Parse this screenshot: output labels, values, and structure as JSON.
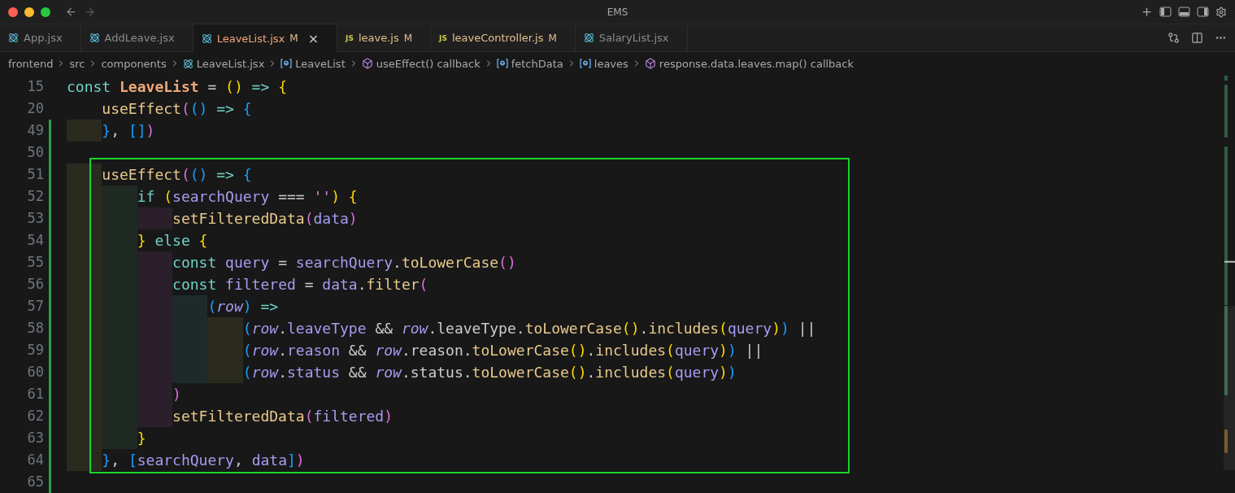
{
  "window": {
    "title": "EMS"
  },
  "tabs": [
    {
      "label": "App.jsx",
      "kind": "react",
      "selected": false
    },
    {
      "label": "AddLeave.jsx",
      "kind": "react",
      "selected": false
    },
    {
      "label": "LeaveList.jsx",
      "kind": "react",
      "selected": true,
      "status": "M",
      "close": "×"
    },
    {
      "label": "leave.js",
      "kind": "js",
      "badge": "JS",
      "selected": false,
      "status": "M"
    },
    {
      "label": "leaveController.js",
      "kind": "js",
      "badge": "JS",
      "selected": false,
      "status": "M"
    },
    {
      "label": "SalaryList.jsx",
      "kind": "react",
      "selected": false
    }
  ],
  "breadcrumbs": [
    {
      "label": "frontend",
      "kind": "folder"
    },
    {
      "label": "src",
      "kind": "folder"
    },
    {
      "label": "components",
      "kind": "folder"
    },
    {
      "label": "LeaveList.jsx",
      "kind": "react"
    },
    {
      "label": "LeaveList",
      "kind": "variable"
    },
    {
      "label": "useEffect() callback",
      "kind": "method"
    },
    {
      "label": "fetchData",
      "kind": "variable"
    },
    {
      "label": "leaves",
      "kind": "variable"
    },
    {
      "label": "response.data.leaves.map() callback",
      "kind": "method"
    }
  ],
  "editor": {
    "blocks": [
      {
        "kind": "plain",
        "lines": [
          {
            "number": "15",
            "modified": false,
            "tokens": [
              {
                "text": "const ",
                "kind": "kw"
              },
              {
                "text": "LeaveList",
                "kind": "cls"
              },
              {
                "text": " = ",
                "kind": "op"
              },
              {
                "text": "()",
                "kind": "b1"
              },
              {
                "text": " => ",
                "kind": "kw"
              },
              {
                "text": "{",
                "kind": "b1"
              }
            ]
          },
          {
            "number": "20",
            "modified": false,
            "guides": [
              {
                "kind": "blank"
              }
            ],
            "tokens": [
              {
                "text": "useEffect",
                "kind": "fn"
              },
              {
                "text": "(",
                "kind": "b2"
              },
              {
                "text": "()",
                "kind": "b3"
              },
              {
                "text": " => ",
                "kind": "kw"
              },
              {
                "text": "{",
                "kind": "b3"
              }
            ]
          },
          {
            "number": "49",
            "modified": true,
            "guides": [
              {
                "kind": "guide",
                "color": "#2a2a1f"
              }
            ],
            "tokens": [
              {
                "text": "}",
                "kind": "b3"
              },
              {
                "text": ", ",
                "kind": "op"
              },
              {
                "text": "[]",
                "kind": "b3"
              },
              {
                "text": ")",
                "kind": "b2"
              }
            ]
          },
          {
            "number": "50",
            "modified": true
          }
        ]
      },
      {
        "kind": "boxed",
        "lines": [
          {
            "number": "51",
            "modified": true,
            "guides": [
              {
                "kind": "guide",
                "color": "#2a2a1f"
              }
            ],
            "tokens": [
              {
                "text": "useEffect",
                "kind": "fn"
              },
              {
                "text": "(",
                "kind": "b2"
              },
              {
                "text": "()",
                "kind": "b3"
              },
              {
                "text": " => ",
                "kind": "kw"
              },
              {
                "text": "{",
                "kind": "b3"
              }
            ]
          },
          {
            "number": "52",
            "modified": true,
            "guides": [
              {
                "kind": "guide",
                "color": "#2a2a1f"
              },
              {
                "kind": "guide",
                "color": "#1f2a22"
              }
            ],
            "tokens": [
              {
                "text": "if ",
                "kind": "kw"
              },
              {
                "text": "(",
                "kind": "b1"
              },
              {
                "text": "searchQuery",
                "kind": "var"
              },
              {
                "text": " === ",
                "kind": "op"
              },
              {
                "text": "''",
                "kind": "str"
              },
              {
                "text": ")",
                "kind": "b1"
              },
              {
                "text": " {",
                "kind": "b1"
              }
            ]
          },
          {
            "number": "53",
            "modified": true,
            "guides": [
              {
                "kind": "guide",
                "color": "#2a2a1f"
              },
              {
                "kind": "guide",
                "color": "#1f2a22"
              },
              {
                "kind": "guide",
                "color": "#2a1f2a"
              }
            ],
            "tokens": [
              {
                "text": "setFilteredData",
                "kind": "fn"
              },
              {
                "text": "(",
                "kind": "b2"
              },
              {
                "text": "data",
                "kind": "var"
              },
              {
                "text": ")",
                "kind": "b2"
              }
            ]
          },
          {
            "number": "54",
            "modified": true,
            "guides": [
              {
                "kind": "guide",
                "color": "#2a2a1f"
              },
              {
                "kind": "guide",
                "color": "#1f2a22"
              }
            ],
            "tokens": [
              {
                "text": "}",
                "kind": "b1"
              },
              {
                "text": " else ",
                "kind": "kw"
              },
              {
                "text": "{",
                "kind": "b1"
              }
            ]
          },
          {
            "number": "55",
            "modified": true,
            "guides": [
              {
                "kind": "guide",
                "color": "#2a2a1f"
              },
              {
                "kind": "guide",
                "color": "#1f2a22"
              },
              {
                "kind": "guide",
                "color": "#2a1f2a"
              }
            ],
            "tokens": [
              {
                "text": "const ",
                "kind": "kw"
              },
              {
                "text": "query",
                "kind": "var"
              },
              {
                "text": " = ",
                "kind": "op"
              },
              {
                "text": "searchQuery",
                "kind": "var"
              },
              {
                "text": ".",
                "kind": "op"
              },
              {
                "text": "toLowerCase",
                "kind": "fn"
              },
              {
                "text": "()",
                "kind": "b2"
              }
            ]
          },
          {
            "number": "56",
            "modified": true,
            "guides": [
              {
                "kind": "guide",
                "color": "#2a2a1f"
              },
              {
                "kind": "guide",
                "color": "#1f2a22"
              },
              {
                "kind": "guide",
                "color": "#2a1f2a"
              }
            ],
            "tokens": [
              {
                "text": "const ",
                "kind": "kw"
              },
              {
                "text": "filtered",
                "kind": "var"
              },
              {
                "text": " = ",
                "kind": "op"
              },
              {
                "text": "data",
                "kind": "var"
              },
              {
                "text": ".",
                "kind": "op"
              },
              {
                "text": "filter",
                "kind": "fn"
              },
              {
                "text": "(",
                "kind": "b2"
              }
            ]
          },
          {
            "number": "57",
            "modified": true,
            "guides": [
              {
                "kind": "guide",
                "color": "#2a2a1f"
              },
              {
                "kind": "guide",
                "color": "#1f2a22"
              },
              {
                "kind": "guide",
                "color": "#2a1f2a"
              },
              {
                "kind": "guide",
                "color": "#1e2a2a"
              }
            ],
            "tokens": [
              {
                "text": "(",
                "kind": "b3"
              },
              {
                "text": "row",
                "kind": "param"
              },
              {
                "text": ")",
                "kind": "b3"
              },
              {
                "text": " =>",
                "kind": "kw"
              }
            ]
          },
          {
            "number": "58",
            "modified": true,
            "guides": [
              {
                "kind": "guide",
                "color": "#2a2a1f"
              },
              {
                "kind": "guide",
                "color": "#1f2a22"
              },
              {
                "kind": "guide",
                "color": "#2a1f2a"
              },
              {
                "kind": "guide",
                "color": "#1e2a2a"
              },
              {
                "kind": "guide",
                "color": "#2a2a1f"
              }
            ],
            "tokens": [
              {
                "text": "(",
                "kind": "b3"
              },
              {
                "text": "row",
                "kind": "param"
              },
              {
                "text": ".",
                "kind": "op"
              },
              {
                "text": "leaveType",
                "kind": "var"
              },
              {
                "text": " && ",
                "kind": "op"
              },
              {
                "text": "row",
                "kind": "param"
              },
              {
                "text": ".leaveType.",
                "kind": "op"
              },
              {
                "text": "toLowerCase",
                "kind": "fn"
              },
              {
                "text": "()",
                "kind": "b1"
              },
              {
                "text": ".",
                "kind": "op"
              },
              {
                "text": "includes",
                "kind": "fn"
              },
              {
                "text": "(",
                "kind": "b1"
              },
              {
                "text": "query",
                "kind": "var"
              },
              {
                "text": ")",
                "kind": "b1"
              },
              {
                "text": ")",
                "kind": "b3"
              },
              {
                "text": " ||",
                "kind": "op"
              }
            ]
          },
          {
            "number": "59",
            "modified": true,
            "guides": [
              {
                "kind": "guide",
                "color": "#2a2a1f"
              },
              {
                "kind": "guide",
                "color": "#1f2a22"
              },
              {
                "kind": "guide",
                "color": "#2a1f2a"
              },
              {
                "kind": "guide",
                "color": "#1e2a2a"
              },
              {
                "kind": "guide",
                "color": "#2a2a1f"
              }
            ],
            "tokens": [
              {
                "text": "(",
                "kind": "b3"
              },
              {
                "text": "row",
                "kind": "param"
              },
              {
                "text": ".",
                "kind": "op"
              },
              {
                "text": "reason",
                "kind": "var"
              },
              {
                "text": " && ",
                "kind": "op"
              },
              {
                "text": "row",
                "kind": "param"
              },
              {
                "text": ".reason.",
                "kind": "op"
              },
              {
                "text": "toLowerCase",
                "kind": "fn"
              },
              {
                "text": "()",
                "kind": "b1"
              },
              {
                "text": ".",
                "kind": "op"
              },
              {
                "text": "includes",
                "kind": "fn"
              },
              {
                "text": "(",
                "kind": "b1"
              },
              {
                "text": "query",
                "kind": "var"
              },
              {
                "text": ")",
                "kind": "b1"
              },
              {
                "text": ")",
                "kind": "b3"
              },
              {
                "text": " ||",
                "kind": "op"
              }
            ]
          },
          {
            "number": "60",
            "modified": true,
            "guides": [
              {
                "kind": "guide",
                "color": "#2a2a1f"
              },
              {
                "kind": "guide",
                "color": "#1f2a22"
              },
              {
                "kind": "guide",
                "color": "#2a1f2a"
              },
              {
                "kind": "guide",
                "color": "#1e2a2a"
              },
              {
                "kind": "guide",
                "color": "#2a2a1f"
              }
            ],
            "tokens": [
              {
                "text": "(",
                "kind": "b3"
              },
              {
                "text": "row",
                "kind": "param"
              },
              {
                "text": ".",
                "kind": "op"
              },
              {
                "text": "status",
                "kind": "var"
              },
              {
                "text": " && ",
                "kind": "op"
              },
              {
                "text": "row",
                "kind": "param"
              },
              {
                "text": ".status.",
                "kind": "op"
              },
              {
                "text": "toLowerCase",
                "kind": "fn"
              },
              {
                "text": "()",
                "kind": "b1"
              },
              {
                "text": ".",
                "kind": "op"
              },
              {
                "text": "includes",
                "kind": "fn"
              },
              {
                "text": "(",
                "kind": "b1"
              },
              {
                "text": "query",
                "kind": "var"
              },
              {
                "text": ")",
                "kind": "b1"
              },
              {
                "text": ")",
                "kind": "b3"
              }
            ]
          },
          {
            "number": "61",
            "modified": true,
            "guides": [
              {
                "kind": "guide",
                "color": "#2a2a1f"
              },
              {
                "kind": "guide",
                "color": "#1f2a22"
              },
              {
                "kind": "guide",
                "color": "#2a1f2a"
              }
            ],
            "tokens": [
              {
                "text": ")",
                "kind": "b2"
              }
            ]
          },
          {
            "number": "62",
            "modified": true,
            "guides": [
              {
                "kind": "guide",
                "color": "#2a2a1f"
              },
              {
                "kind": "guide",
                "color": "#1f2a22"
              },
              {
                "kind": "guide",
                "color": "#2a1f2a"
              }
            ],
            "tokens": [
              {
                "text": "setFilteredData",
                "kind": "fn"
              },
              {
                "text": "(",
                "kind": "b2"
              },
              {
                "text": "filtered",
                "kind": "var"
              },
              {
                "text": ")",
                "kind": "b2"
              }
            ]
          },
          {
            "number": "63",
            "modified": true,
            "guides": [
              {
                "kind": "guide",
                "color": "#2a2a1f"
              },
              {
                "kind": "guide",
                "color": "#1f2a22"
              }
            ],
            "tokens": [
              {
                "text": "}",
                "kind": "b1"
              }
            ]
          },
          {
            "number": "64",
            "modified": true,
            "guides": [
              {
                "kind": "guide",
                "color": "#2a2a1f"
              }
            ],
            "tokens": [
              {
                "text": "}",
                "kind": "b3"
              },
              {
                "text": ", ",
                "kind": "op"
              },
              {
                "text": "[",
                "kind": "b3"
              },
              {
                "text": "searchQuery",
                "kind": "var"
              },
              {
                "text": ", ",
                "kind": "op"
              },
              {
                "text": "data",
                "kind": "var"
              },
              {
                "text": "]",
                "kind": "b3"
              },
              {
                "text": ")",
                "kind": "b2"
              }
            ]
          }
        ]
      },
      {
        "kind": "plain",
        "lines": [
          {
            "number": "65",
            "modified": true
          }
        ]
      }
    ]
  }
}
